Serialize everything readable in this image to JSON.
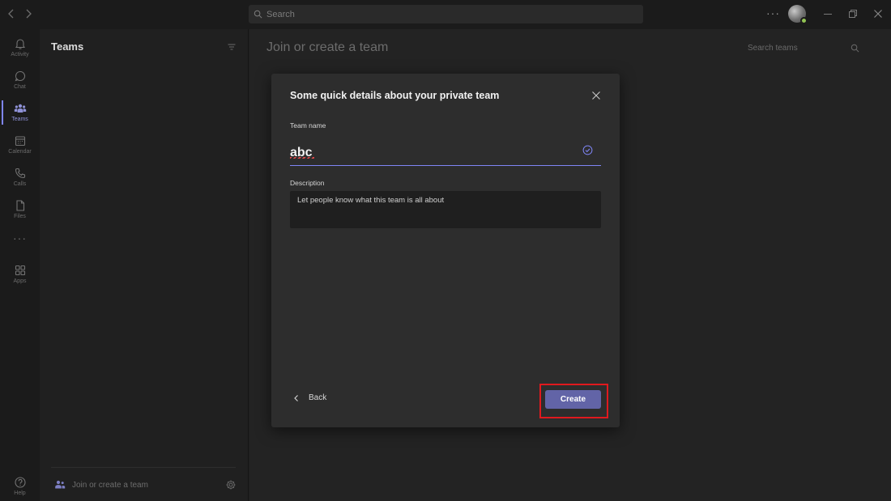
{
  "titlebar": {
    "search_placeholder": "Search",
    "more_label": "···"
  },
  "rail": {
    "items": [
      {
        "label": "Activity",
        "icon": "bell-icon"
      },
      {
        "label": "Chat",
        "icon": "chat-icon"
      },
      {
        "label": "Teams",
        "icon": "teams-icon",
        "active": true
      },
      {
        "label": "Calendar",
        "icon": "calendar-icon"
      },
      {
        "label": "Calls",
        "icon": "phone-icon"
      },
      {
        "label": "Files",
        "icon": "file-icon"
      },
      {
        "label": "Apps",
        "icon": "apps-icon"
      },
      {
        "label": "Help",
        "icon": "help-icon"
      }
    ],
    "more_label": "···"
  },
  "panel": {
    "title": "Teams",
    "join_label": "Join or create a team"
  },
  "main": {
    "title": "Join or create a team",
    "search_placeholder": "Search teams"
  },
  "dialog": {
    "title": "Some quick details about your private team",
    "team_name_label": "Team name",
    "team_name_value": "abc",
    "description_label": "Description",
    "description_placeholder": "Let people know what this team is all about",
    "back_label": "Back",
    "create_label": "Create"
  },
  "colors": {
    "accent": "#6264a7",
    "highlight": "#e0191e",
    "presence": "#92c353"
  }
}
